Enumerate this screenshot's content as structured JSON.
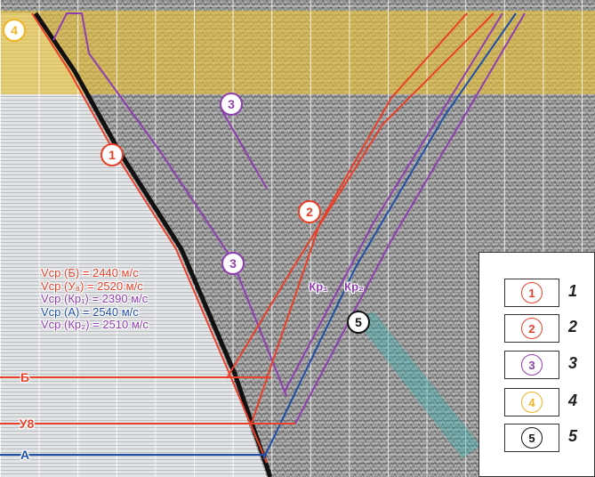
{
  "colors": {
    "red": "#e8402a",
    "purple": "#8e3fb0",
    "blue": "#1f4fa8",
    "yellow": "#f0b323",
    "black": "#111111"
  },
  "horizons": [
    {
      "label": "Б",
      "color": "#e8402a"
    },
    {
      "label": "У8",
      "color": "#e8402a"
    },
    {
      "label": "А",
      "color": "#1f4fa8"
    }
  ],
  "markers": [
    {
      "text": "1",
      "color": "#e8402a"
    },
    {
      "text": "2",
      "color": "#e8402a"
    },
    {
      "text": "3",
      "color": "#8e3fb0"
    },
    {
      "text": "3",
      "color": "#8e3fb0"
    },
    {
      "text": "4",
      "color": "#f0b323"
    },
    {
      "text": "5",
      "color": "#111111"
    }
  ],
  "wave_labels": [
    "Кр₁",
    "Кр₂"
  ],
  "velocities": [
    {
      "text": "Vср (Б) = 2440 м/с",
      "color": "#e8402a"
    },
    {
      "text": "Vср (У₈) = 2520 м/с",
      "color": "#e8402a"
    },
    {
      "text": "Vср (Кр₁) = 2390 м/с",
      "color": "#8e3fb0"
    },
    {
      "text": "Vср (А) = 2540 м/с",
      "color": "#1f4fa8"
    },
    {
      "text": "Vср (Кр₂) = 2510 м/с",
      "color": "#8e3fb0"
    }
  ],
  "legend": [
    {
      "symbol": "1",
      "color": "#e8402a",
      "number": "1"
    },
    {
      "symbol": "2",
      "color": "#e8402a",
      "number": "2"
    },
    {
      "symbol": "3",
      "color": "#8e3fb0",
      "number": "3"
    },
    {
      "symbol": "4",
      "color": "#f0b323",
      "number": "4"
    },
    {
      "symbol": "5",
      "color": "#111111",
      "number": "5"
    }
  ]
}
